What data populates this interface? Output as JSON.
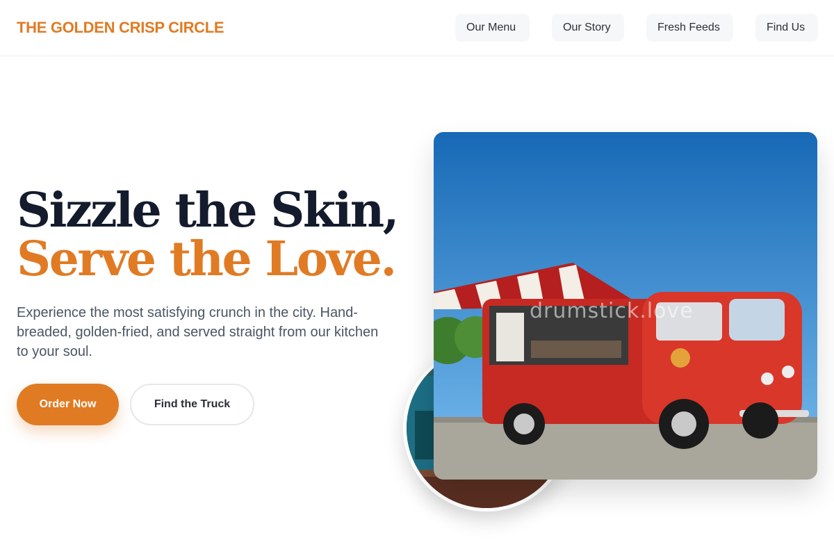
{
  "brand": {
    "name": "THE GOLDEN CRISP CIRCLE"
  },
  "nav": {
    "items": [
      {
        "label": "Our Menu"
      },
      {
        "label": "Our Story"
      },
      {
        "label": "Fresh Feeds"
      },
      {
        "label": "Find Us"
      }
    ]
  },
  "hero": {
    "headline_line1": "Sizzle the Skin,",
    "headline_line2": "Serve the Love.",
    "subtext": "Experience the most satisfying crunch in the city. Hand-breaded, golden-fried, and served straight from our kitchen to your soul.",
    "primary_button": "Order Now",
    "secondary_button": "Find the Truck",
    "photo_watermark": "drumstick.love"
  },
  "colors": {
    "accent": "#e07b24",
    "headline_dark": "#141b2d",
    "body_text": "#4b5563"
  }
}
